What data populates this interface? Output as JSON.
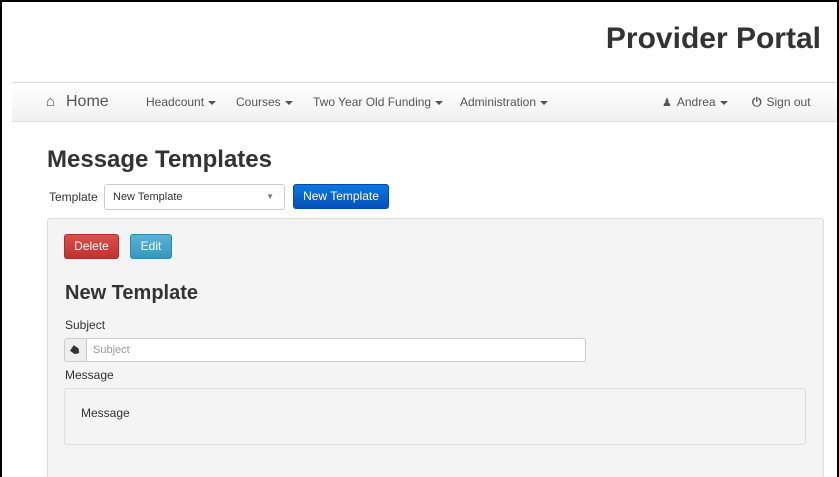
{
  "brand": {
    "title": "Provider Portal"
  },
  "navbar": {
    "home_label": "Home",
    "items": [
      {
        "label": "Headcount"
      },
      {
        "label": "Courses"
      },
      {
        "label": "Two Year Old Funding"
      },
      {
        "label": "Administration"
      }
    ],
    "user_label": "Andrea",
    "signout_label": "Sign out"
  },
  "page": {
    "title": "Message Templates",
    "template_label": "Template",
    "template_selected": "New Template",
    "new_template_button": "New Template"
  },
  "panel": {
    "delete_label": "Delete",
    "edit_label": "Edit",
    "title": "New Template",
    "subject_label": "Subject",
    "subject_placeholder": "Subject",
    "subject_value": "",
    "message_label": "Message",
    "message_text": "Message"
  },
  "colors": {
    "primary": "#0a64cc",
    "danger": "#cd3f3b",
    "info": "#46a4ca",
    "navbar_bg": "#f5f5f5",
    "panel_bg": "#f4f4f4"
  },
  "icons": [
    "home-icon",
    "user-icon",
    "power-icon",
    "tag-icon",
    "chevron-down-icon"
  ]
}
